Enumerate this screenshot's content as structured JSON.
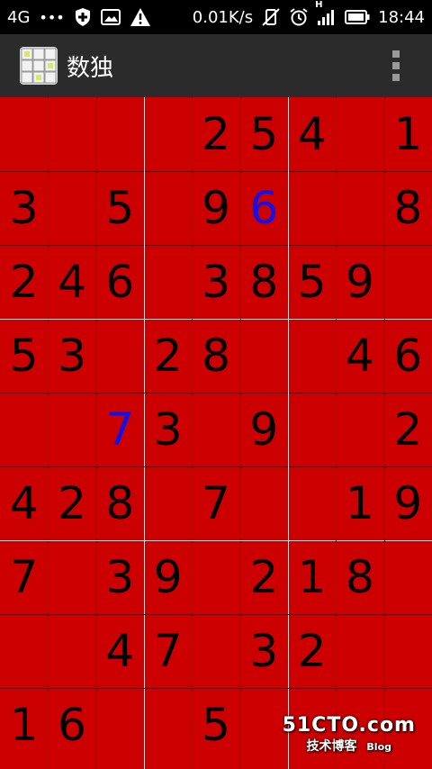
{
  "status_bar": {
    "network": "4G",
    "dots": "•••",
    "speed": "0.01K/s",
    "signal_letter": "H",
    "time": "18:44"
  },
  "action_bar": {
    "title": "数独"
  },
  "board": {
    "rows": [
      [
        "",
        "",
        "",
        "",
        "2",
        "5",
        "4",
        "",
        "1"
      ],
      [
        "3",
        "",
        "5",
        "",
        "9",
        "6",
        "",
        "",
        "8"
      ],
      [
        "2",
        "4",
        "6",
        "",
        "3",
        "8",
        "5",
        "9",
        ""
      ],
      [
        "5",
        "3",
        "",
        "2",
        "8",
        "",
        "",
        "4",
        "6"
      ],
      [
        "",
        "",
        "7",
        "3",
        "",
        "9",
        "",
        "",
        "2"
      ],
      [
        "4",
        "2",
        "8",
        "",
        "7",
        "",
        "",
        "1",
        "9"
      ],
      [
        "7",
        "",
        "3",
        "9",
        "",
        "2",
        "1",
        "8",
        ""
      ],
      [
        "",
        "",
        "4",
        "7",
        "",
        "3",
        "2",
        "",
        ""
      ],
      [
        "1",
        "6",
        "",
        "",
        "5",
        "",
        "",
        "",
        ""
      ]
    ],
    "user_entries": [
      [
        1,
        5
      ],
      [
        4,
        2
      ]
    ],
    "colors": {
      "background": "#cc0000",
      "given_digit": "#000000",
      "user_digit": "#1111ee"
    }
  },
  "watermark": {
    "main": "51CTO.com",
    "sub": "技术博客",
    "tag": "Blog"
  }
}
